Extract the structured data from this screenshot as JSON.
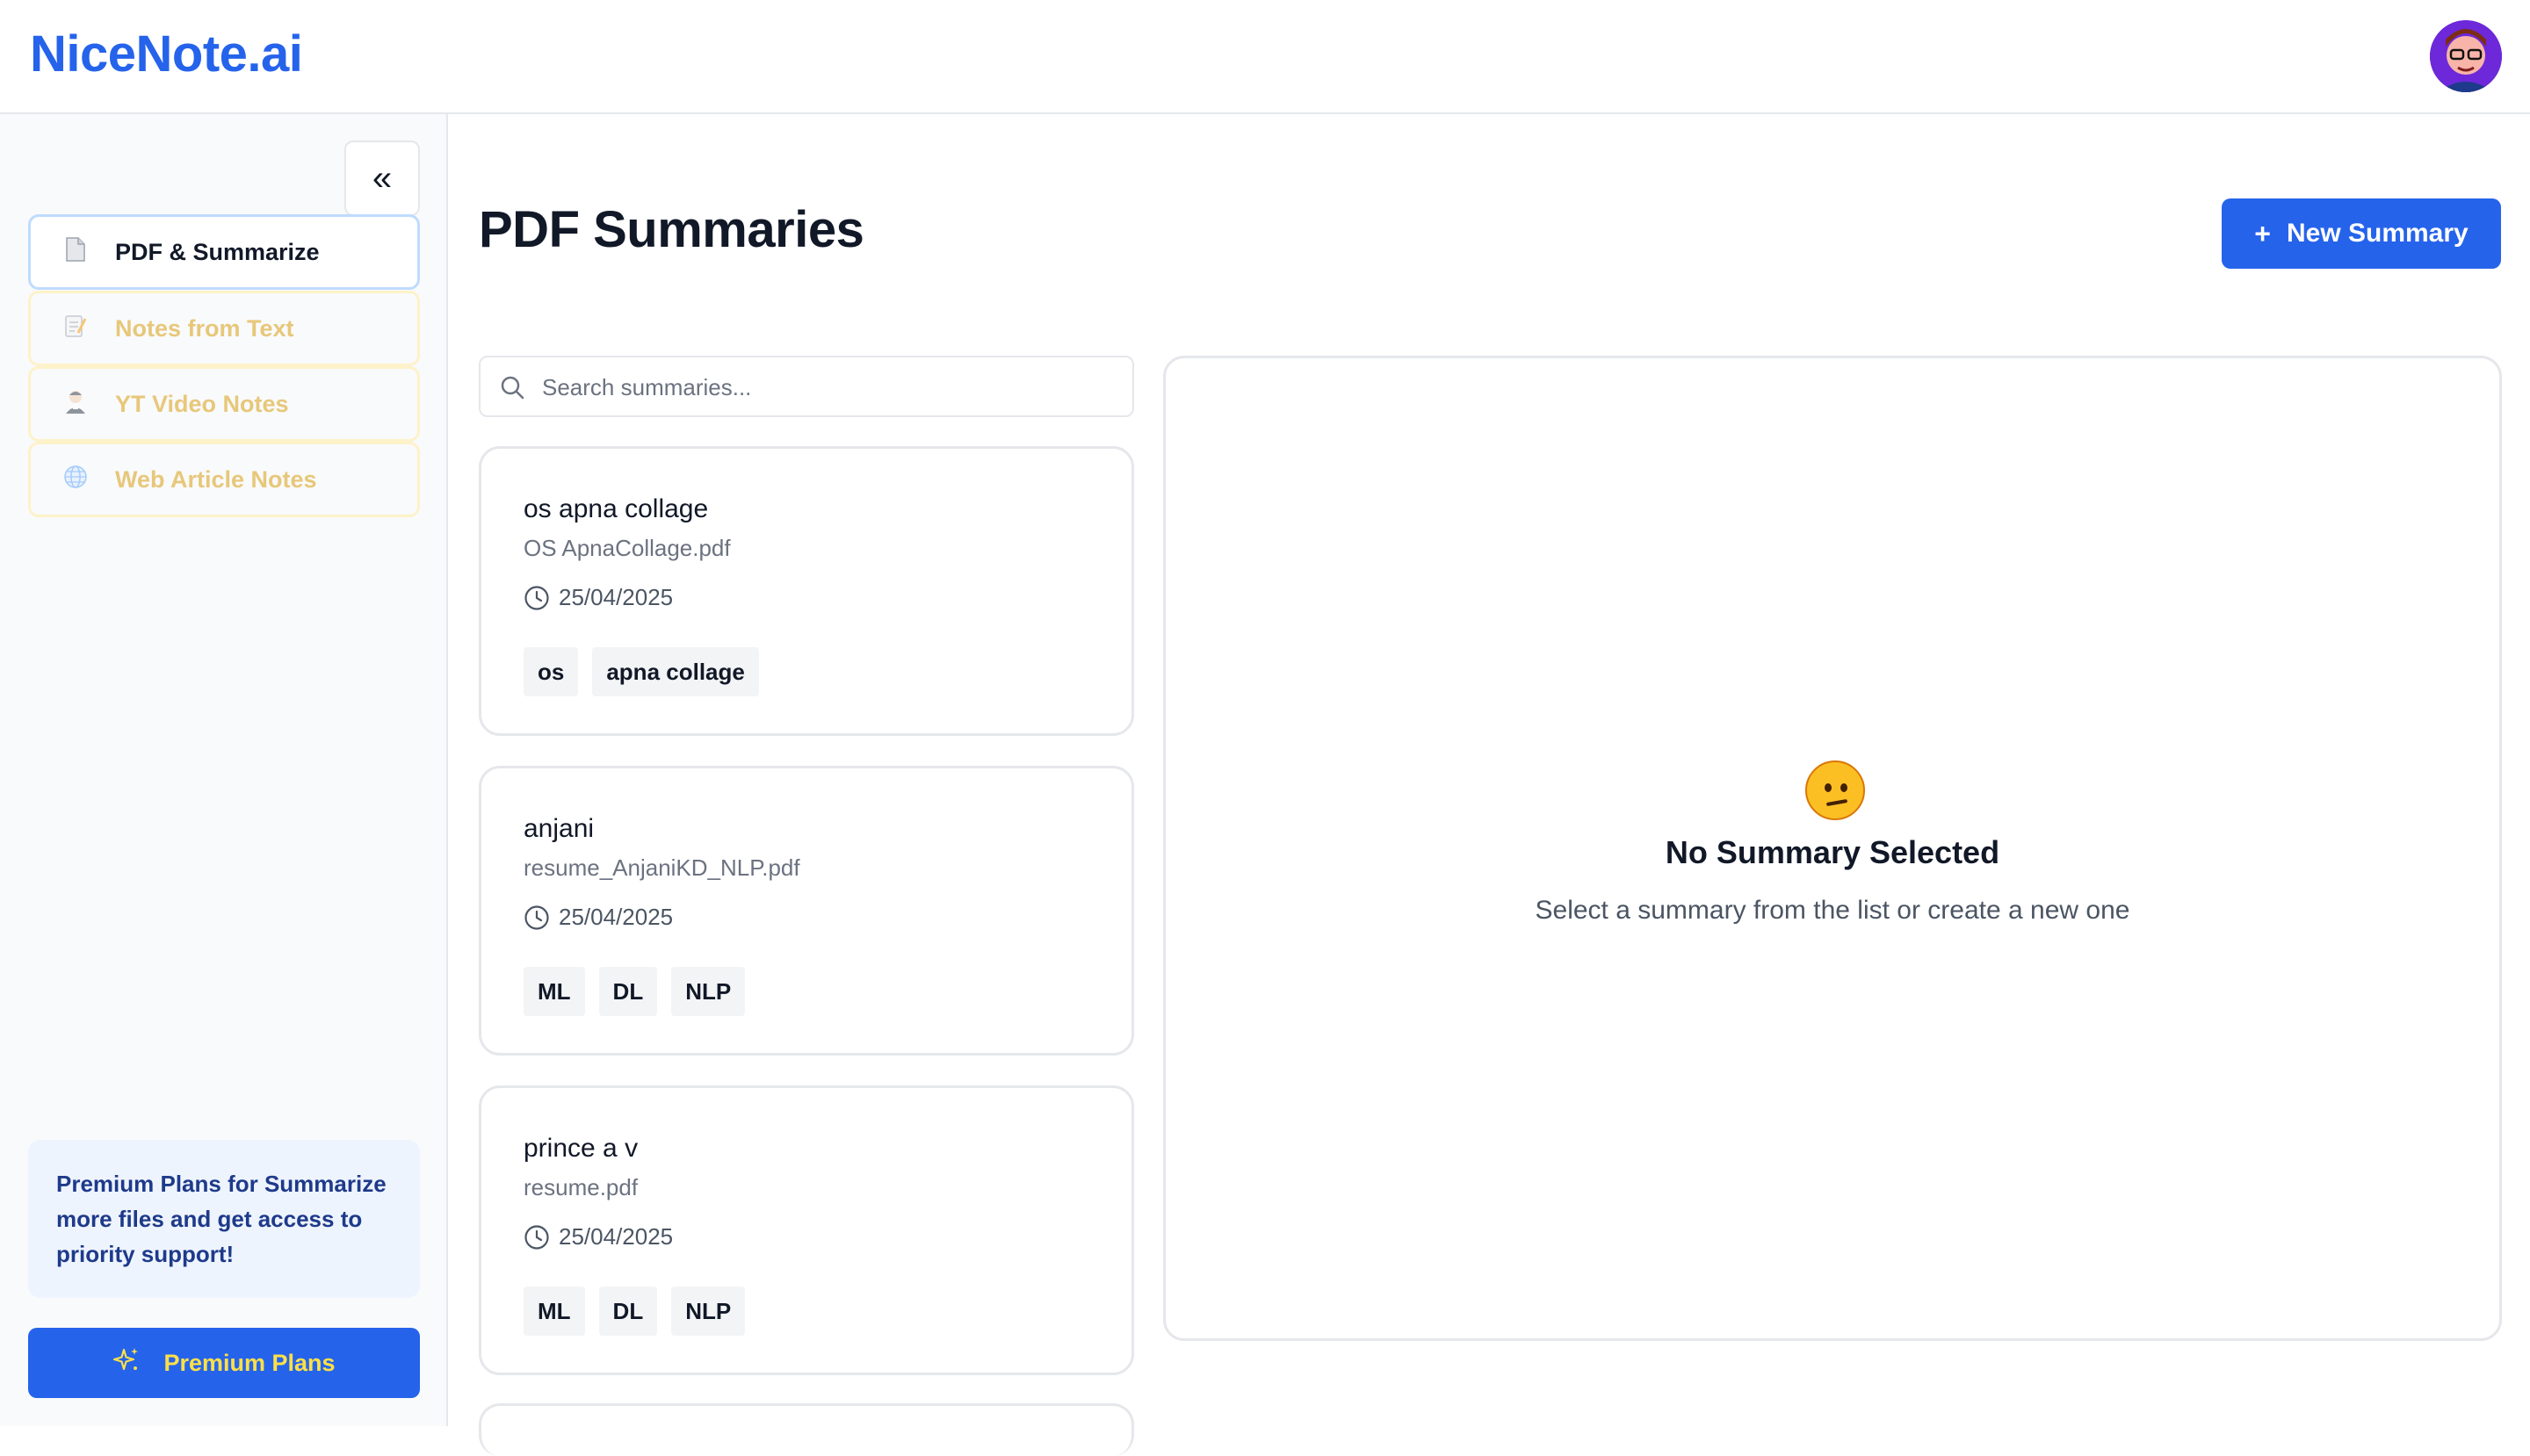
{
  "app": {
    "logo": "NiceNote.ai"
  },
  "sidebar": {
    "collapse_label": "«",
    "items": [
      {
        "label": "PDF & Summarize",
        "icon": "document-icon",
        "active": true
      },
      {
        "label": "Notes from Text",
        "icon": "memo-icon",
        "active": false
      },
      {
        "label": "YT Video Notes",
        "icon": "teacher-icon",
        "active": false
      },
      {
        "label": "Web Article Notes",
        "icon": "globe-icon",
        "active": false
      }
    ],
    "promo_text": "Premium Plans for Summarize more files and get access to priority support!",
    "premium_button": "Premium Plans"
  },
  "main": {
    "title": "PDF Summaries",
    "new_button": "New Summary",
    "search": {
      "placeholder": "Search summaries...",
      "value": ""
    },
    "summaries": [
      {
        "title": "os apna collage",
        "file": "OS ApnaCollage.pdf",
        "date": "25/04/2025",
        "tags": [
          "os",
          "apna collage"
        ]
      },
      {
        "title": "anjani",
        "file": "resume_AnjaniKD_NLP.pdf",
        "date": "25/04/2025",
        "tags": [
          "ML",
          "DL",
          "NLP"
        ]
      },
      {
        "title": "prince a v",
        "file": "resume.pdf",
        "date": "25/04/2025",
        "tags": [
          "ML",
          "DL",
          "NLP"
        ]
      }
    ],
    "empty_state": {
      "title": "No Summary Selected",
      "subtitle": "Select a summary from the list or create a new one"
    }
  },
  "colors": {
    "accent": "#2563eb",
    "premium_text": "#fde047",
    "dim_nav": "#e7c77a"
  }
}
